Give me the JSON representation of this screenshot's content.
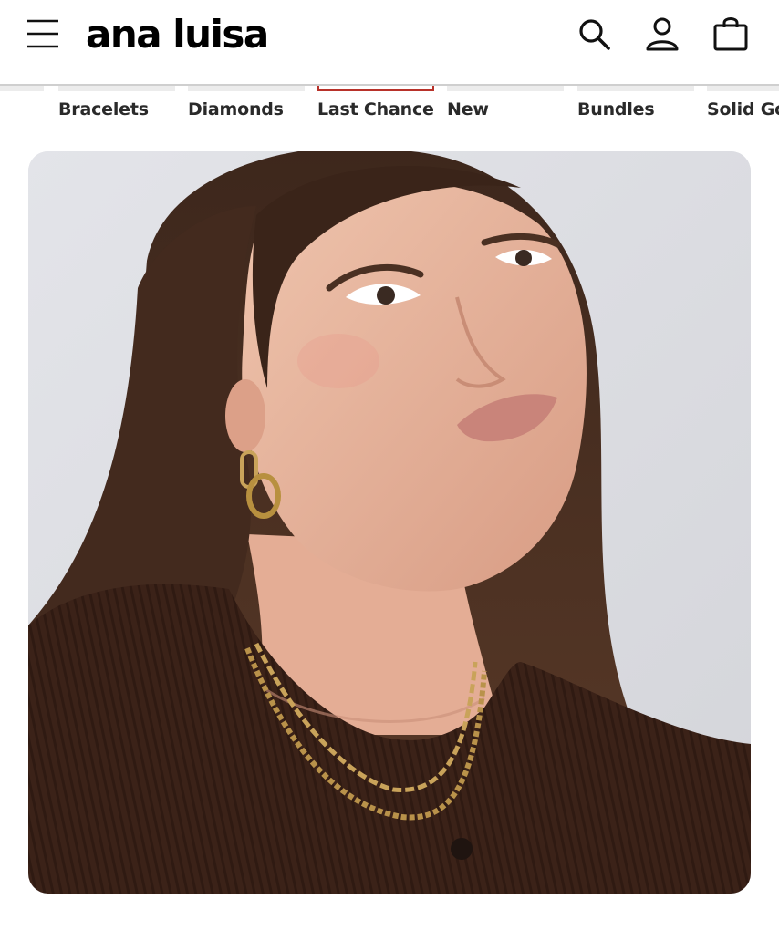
{
  "header": {
    "brand": "ana luisa",
    "icons": {
      "menu": "hamburger-menu-icon",
      "search": "search-icon",
      "account": "user-account-icon",
      "bag": "shopping-bag-icon"
    }
  },
  "nav": {
    "items": [
      {
        "label": ""
      },
      {
        "label": "Bracelets"
      },
      {
        "label": "Diamonds"
      },
      {
        "label": "Last Chance",
        "active": true
      },
      {
        "label": "New"
      },
      {
        "label": "Bundles"
      },
      {
        "label": "Solid Gold"
      }
    ],
    "active_color": "#b8322a"
  },
  "hero": {
    "image": "model-wearing-gold-chain-earrings-and-necklaces"
  }
}
